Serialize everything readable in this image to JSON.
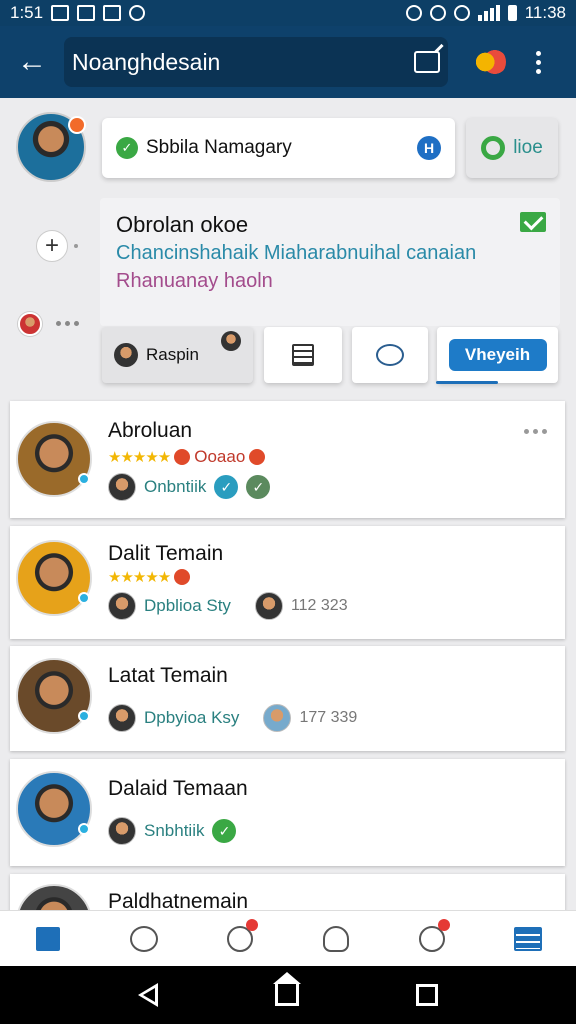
{
  "status_bar": {
    "time_left": "1:51",
    "time_right": "11:38"
  },
  "app_bar": {
    "title": "Noanghdesain"
  },
  "profile": {
    "name": "Sbbila Namagary",
    "h_badge": "H",
    "like_label": "lioe"
  },
  "post": {
    "title": "Obrolan okoe",
    "line1": "Chancinshahaik Miaharabnuihal canaian",
    "line2": "Rhanuanay haoln"
  },
  "actions": {
    "reply_label": "Raspin",
    "primary_label": "Vheyeih"
  },
  "friends": [
    {
      "name": "Abroluan",
      "stars": "★★★★★",
      "rating_text": "Ooaao",
      "sub_text": "Onbntiik",
      "count": ""
    },
    {
      "name": "Dalit Temain",
      "stars": "★★★★★",
      "rating_text": "",
      "sub_text": "Dpblioa Sty",
      "count": "112 323"
    },
    {
      "name": "Latat Temain",
      "stars": "",
      "rating_text": "",
      "sub_text": "Dpbyioa Ksy",
      "count": "177 339"
    },
    {
      "name": "Dalaid Temaan",
      "stars": "",
      "rating_text": "",
      "sub_text": "Snbhtiik",
      "count": ""
    },
    {
      "name": "Paldhatnemain",
      "stars": "",
      "rating_text": "",
      "sub_text": "",
      "count": ""
    }
  ]
}
